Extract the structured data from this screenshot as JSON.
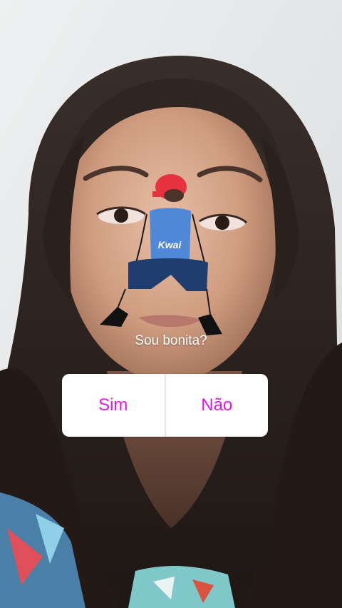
{
  "colors": {
    "option_text": "#e614e6",
    "card_bg": "#ffffff",
    "question_text": "#ffffff"
  },
  "sticker": {
    "icon": "kwai-dancer-sticker",
    "shirt_text": "Kwai"
  },
  "poll": {
    "question": "Sou bonita?",
    "options": [
      {
        "label": "Sim"
      },
      {
        "label": "Não"
      }
    ]
  }
}
